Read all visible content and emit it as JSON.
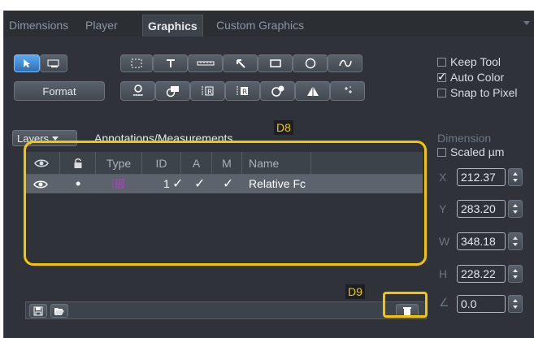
{
  "tabs": [
    {
      "label": "Dimensions",
      "active": false
    },
    {
      "label": "Player",
      "active": false
    },
    {
      "label": "Graphics",
      "active": true
    },
    {
      "label": "Custom Graphics",
      "active": false
    }
  ],
  "toolbar": {
    "format_label": "Format",
    "tools_row1": [
      "select-arrow-icon",
      "text-box-icon",
      "rectangle-select-icon",
      "text-t-icon",
      "scale-bar-icon",
      "arrow-icon",
      "rectangle-icon",
      "circle-icon",
      "curve-icon"
    ],
    "tools_row2": [
      "scale-marker-icon",
      "object-marker-icon",
      "frame-label-icon",
      "frame-label-b-icon",
      "circle-color-icon",
      "triangle-icon",
      "points-icon"
    ]
  },
  "options": {
    "keep_tool": {
      "label": "Keep Tool",
      "checked": false
    },
    "auto_color": {
      "label": "Auto Color",
      "checked": true
    },
    "snap_to_pixel": {
      "label": "Snap to Pixel",
      "checked": false
    }
  },
  "layers": {
    "button_label": "Layers",
    "title": "Annotations/Measurements",
    "columns": [
      "Type",
      "ID",
      "A",
      "M",
      "Name"
    ],
    "rows": [
      {
        "visible": true,
        "locked": false,
        "type_icon": "frame-label-icon",
        "id": "1",
        "a": true,
        "m": true,
        "name": "Relative Fc"
      }
    ]
  },
  "annotations": {
    "d8": "D8",
    "d9": "D9"
  },
  "dimension": {
    "header": "Dimension",
    "scaled_label": "Scaled µm",
    "scaled_checked": false,
    "fields": [
      {
        "label": "X",
        "value": "212.37"
      },
      {
        "label": "Y",
        "value": "283.20"
      },
      {
        "label": "W",
        "value": "348.18"
      },
      {
        "label": "H",
        "value": "228.22"
      },
      {
        "label": "∠",
        "value": "0.0"
      }
    ]
  },
  "colors": {
    "accent": "#2e6fb8",
    "highlight": "#f2c700",
    "panel_bg": "#2f3339"
  }
}
